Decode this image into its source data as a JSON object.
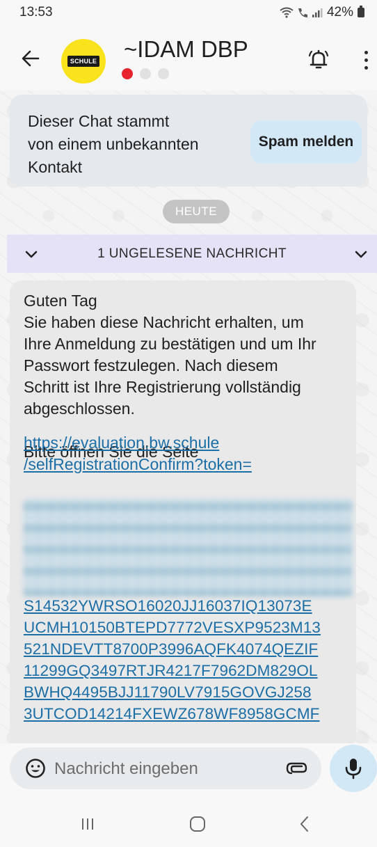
{
  "status_bar": {
    "time": "13:53",
    "battery": "42%",
    "icons": [
      "wifi-icon",
      "call-signal-icon",
      "signal-bars-icon",
      "battery-icon"
    ]
  },
  "header": {
    "title": "~IDAM DBP",
    "avatar_text": "SCHULE",
    "avatar_color": "#f9e31c",
    "page_dots": 3,
    "active_dot_color": "#e8232d",
    "icons": [
      "back-arrow-icon",
      "bell-icon",
      "more-vert-icon"
    ]
  },
  "spam_banner": {
    "text": "Dieser Chat stammt\nvon einem unbekannten\nKontakt",
    "button_label": "Spam melden"
  },
  "date_chip": "HEUTE",
  "unread_bar": {
    "label": "1 UNGELESENE NACHRICHT"
  },
  "message": {
    "text": "Guten Tag\nSie haben diese Nachricht erhalten, um\nIhre Anmeldung zu bestätigen und um Ihr\nPasswort festzulegen. Nach diesem\nSchritt ist Ihre Registrierung vollständig\nabgeschlossen.\n\nBitte öffnen Sie die Seite",
    "link_lines": [
      "https://evaluation.bw.schule",
      "/selfRegistrationConfirm?token="
    ],
    "token_lines": [
      "S14532YWRSO16020JJ16037IQ13073E",
      "UCMH10150BTEPD7772VESXP9523M13",
      "521NDEVTT8700P3996AQFK4074QEZIF",
      "11299GQ3497RTJR4217F7962DM829OL",
      "BWHQ4495BJJ11790LV7915GOVGJ258",
      "3UTCOD14214FXEWZ678WF8958GCMF"
    ],
    "link_color": "#1b6ea6"
  },
  "input": {
    "placeholder": "Nachricht eingeben",
    "icons": [
      "emoji-icon",
      "attach-icon",
      "mic-icon"
    ]
  },
  "nav": {
    "icons": [
      "recent-apps-icon",
      "home-icon",
      "back-icon"
    ]
  }
}
